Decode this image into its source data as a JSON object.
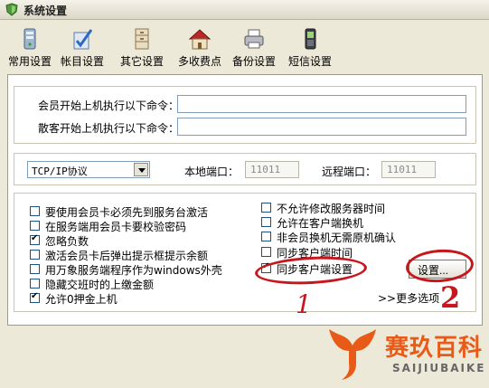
{
  "window": {
    "title": "系统设置"
  },
  "toolbar": {
    "items": [
      {
        "label": "常用设置",
        "icon": "server-icon"
      },
      {
        "label": "帐目设置",
        "icon": "check-clipboard-icon"
      },
      {
        "label": "其它设置",
        "icon": "cabinet-icon"
      },
      {
        "label": "多收费点",
        "icon": "house-icon"
      },
      {
        "label": "备份设置",
        "icon": "printer-icon"
      },
      {
        "label": "短信设置",
        "icon": "mobile-phone-icon"
      }
    ]
  },
  "commands": {
    "member_label": "会员开始上机执行以下命令：",
    "member_value": "",
    "guest_label": "散客开始上机执行以下命令：",
    "guest_value": ""
  },
  "network": {
    "protocol": "TCP/IP协议",
    "local_port_label": "本地端口：",
    "local_port": "11011",
    "remote_port_label": "远程端口：",
    "remote_port": "11011"
  },
  "options": {
    "left": [
      {
        "label": "要使用会员卡必须先到服务台激活",
        "checked": false
      },
      {
        "label": "在服务端用会员卡要校验密码",
        "checked": false
      },
      {
        "label": "忽略负数",
        "checked": true
      },
      {
        "label": "激活会员卡后弹出提示框提示余额",
        "checked": false
      },
      {
        "label": "用万象服务端程序作为windows外壳",
        "checked": false
      },
      {
        "label": "隐藏交班时的上缴金额",
        "checked": false
      },
      {
        "label": "允许0押金上机",
        "checked": true
      }
    ],
    "right": [
      {
        "label": "不允许修改服务器时间",
        "checked": false
      },
      {
        "label": "允许在客户端换机",
        "checked": false
      },
      {
        "label": "非会员换机无需原机确认",
        "checked": false
      },
      {
        "label": "同步客户端时间",
        "checked": false
      },
      {
        "label": "同步客户端设置",
        "checked": true
      }
    ],
    "settings_button": "设置...",
    "more_options": ">>更多选项"
  },
  "annotations": {
    "one": "1",
    "two": "2",
    "color": "#c8161e"
  },
  "watermark": {
    "cn": "赛玖百科",
    "en": "SAIJIUBAIKE",
    "color": "#e85a17"
  }
}
